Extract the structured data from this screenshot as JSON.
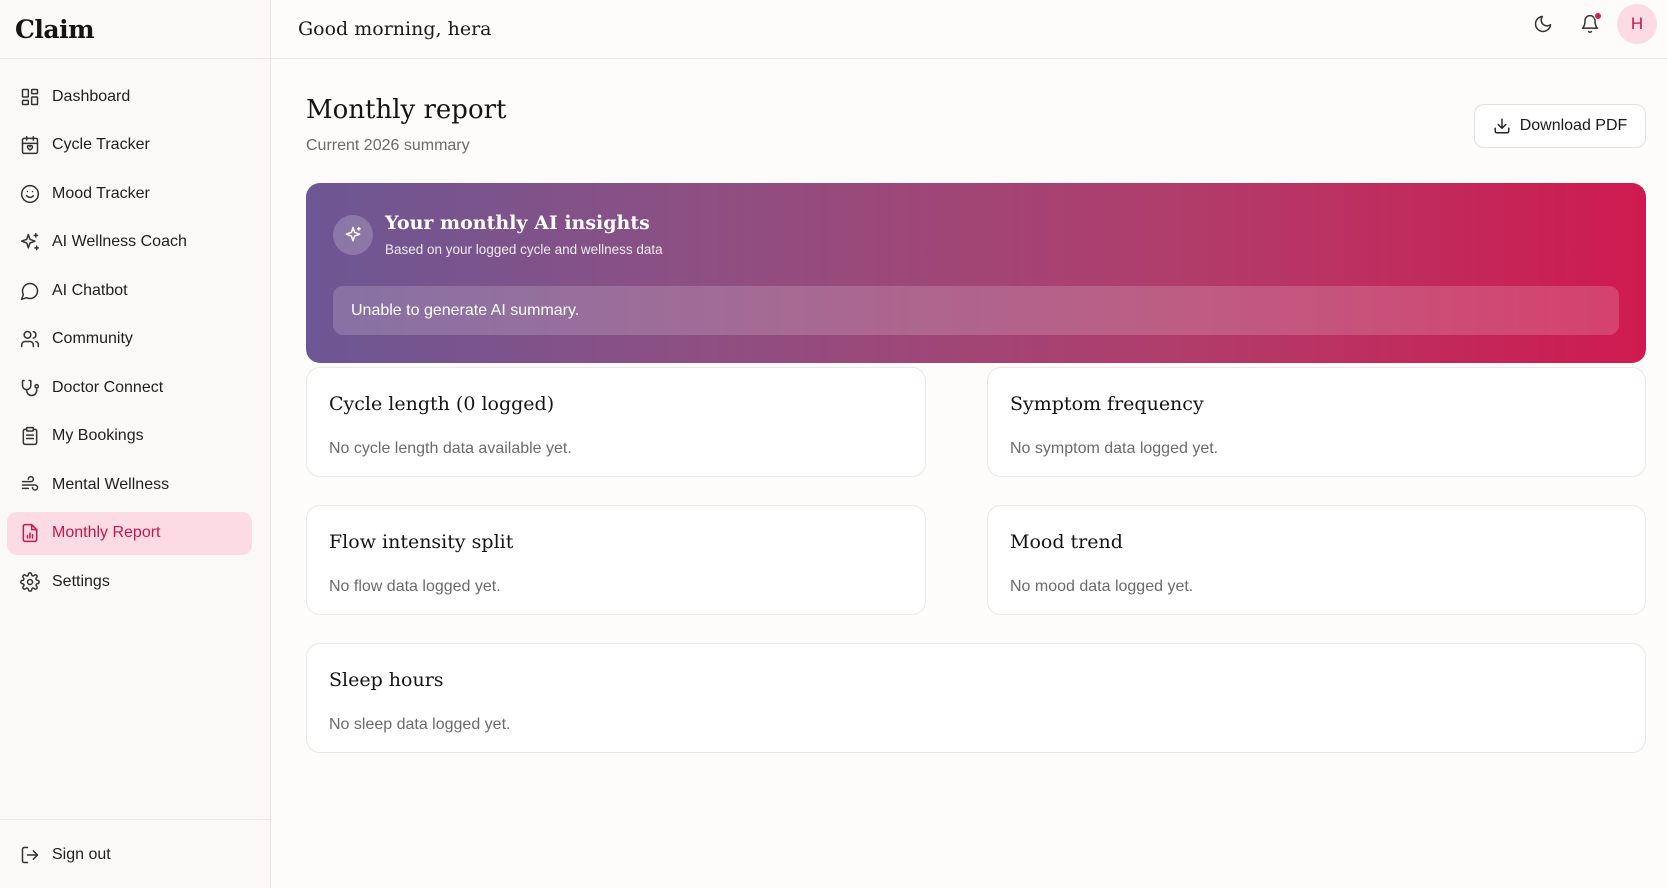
{
  "sidebar": {
    "brand": "Claim",
    "items": [
      {
        "label": "Dashboard",
        "icon": "dashboard-icon"
      },
      {
        "label": "Cycle Tracker",
        "icon": "calendar-icon"
      },
      {
        "label": "Mood Tracker",
        "icon": "smile-icon"
      },
      {
        "label": "AI Wellness Coach",
        "icon": "sparkles-icon"
      },
      {
        "label": "AI Chatbot",
        "icon": "chat-bubble-icon"
      },
      {
        "label": "Community",
        "icon": "users-icon"
      },
      {
        "label": "Doctor Connect",
        "icon": "stethoscope-icon"
      },
      {
        "label": "My Bookings",
        "icon": "clipboard-icon"
      },
      {
        "label": "Mental Wellness",
        "icon": "wind-icon"
      },
      {
        "label": "Monthly Report",
        "icon": "file-chart-icon",
        "active": true
      },
      {
        "label": "Settings",
        "icon": "gear-icon"
      }
    ],
    "signout_label": "Sign out"
  },
  "topbar": {
    "greeting": "Good morning, hera",
    "avatar_initial": "H",
    "has_notification": true
  },
  "page": {
    "title": "Monthly report",
    "subtitle": "Current 2026 summary",
    "download_label": "Download PDF"
  },
  "ai_insights": {
    "title": "Your monthly AI insights",
    "subtitle": "Based on your logged cycle and wellness data",
    "message": "Unable to generate AI summary."
  },
  "cards": [
    {
      "title": "Cycle length (0 logged)",
      "empty": "No cycle length data available yet."
    },
    {
      "title": "Symptom frequency",
      "empty": "No symptom data logged yet."
    },
    {
      "title": "Flow intensity split",
      "empty": "No flow data logged yet."
    },
    {
      "title": "Mood trend",
      "empty": "No mood data logged yet."
    },
    {
      "title": "Sleep hours",
      "empty": "No sleep data logged yet."
    }
  ],
  "colors": {
    "accent": "#c4164f",
    "accent_bg": "#fddbe4",
    "gradient_start": "#6c5794",
    "gradient_end": "#cf1a4f"
  }
}
